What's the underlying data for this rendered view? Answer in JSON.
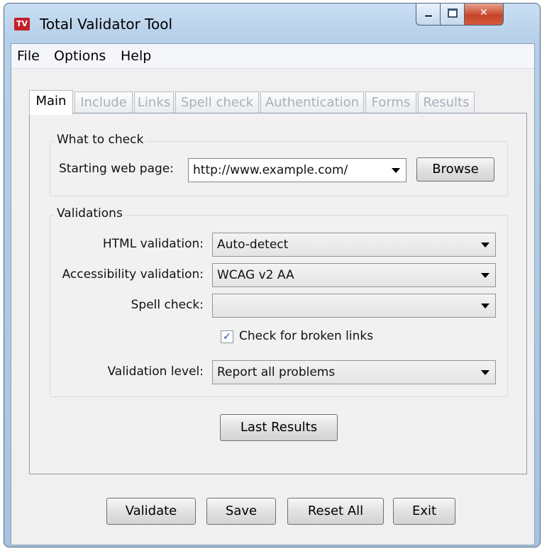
{
  "window": {
    "title": "Total Validator Tool",
    "icon_text": "TV",
    "close_glyph": "✕"
  },
  "menu": [
    "File",
    "Options",
    "Help"
  ],
  "tabs": [
    {
      "label": "Main",
      "active": true
    },
    {
      "label": "Include",
      "active": false
    },
    {
      "label": "Links",
      "active": false
    },
    {
      "label": "Spell check",
      "active": false
    },
    {
      "label": "Authentication",
      "active": false
    },
    {
      "label": "Forms",
      "active": false
    },
    {
      "label": "Results",
      "active": false
    }
  ],
  "what_to_check": {
    "legend": "What to check",
    "start_label": "Starting web page:",
    "start_value": "http://www.example.com/",
    "browse": "Browse"
  },
  "validations": {
    "legend": "Validations",
    "html_label": "HTML validation:",
    "html_value": "Auto-detect",
    "access_label": "Accessibility validation:",
    "access_value": "WCAG v2 AA",
    "spell_label": "Spell check:",
    "spell_value": "",
    "broken_links_label": "Check for broken links",
    "broken_links_checked": true,
    "check_mark": "✓",
    "level_label": "Validation level:",
    "level_value": "Report all problems"
  },
  "panel_buttons": {
    "last_results": "Last Results"
  },
  "footer_buttons": {
    "validate": "Validate",
    "save": "Save",
    "reset_all": "Reset All",
    "exit": "Exit"
  },
  "colors": {
    "title_bar": "#b7cfe8",
    "close_button": "#c7442a",
    "disabled_tab_text": "#a9afb8"
  }
}
